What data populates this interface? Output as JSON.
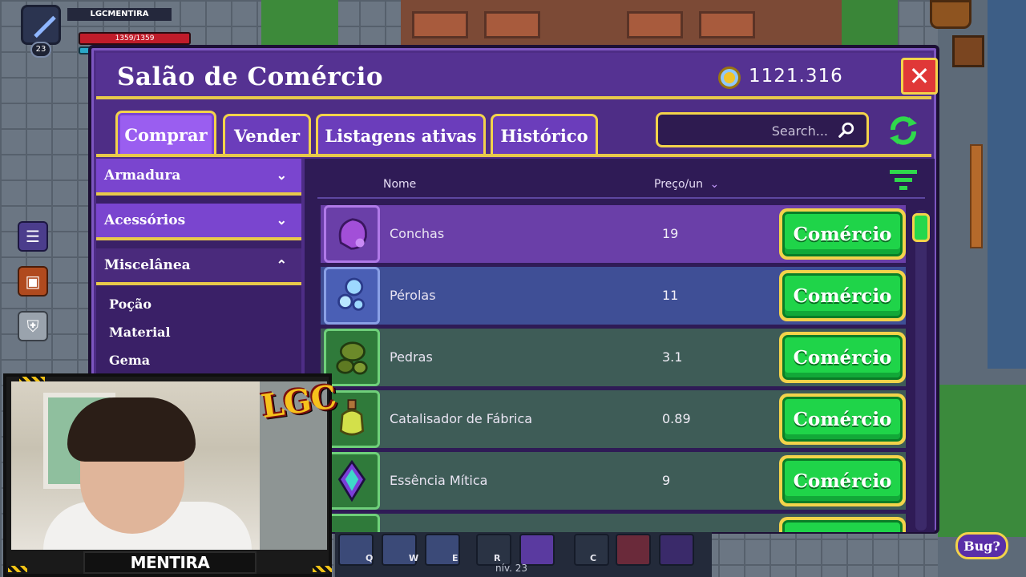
{
  "hud": {
    "player_name": "LGCMENTIRA",
    "hp": "1359/1359",
    "level": "23"
  },
  "window": {
    "title": "Salão de Comércio",
    "gold": "1121.316",
    "close_label": "✕"
  },
  "tabs": [
    {
      "label": "Comprar",
      "active": true
    },
    {
      "label": "Vender",
      "active": false
    },
    {
      "label": "Listagens ativas",
      "active": false
    },
    {
      "label": "Histórico",
      "active": false
    }
  ],
  "search": {
    "placeholder": "Search..."
  },
  "categories": [
    {
      "label": "Armadura",
      "chevron": "⌄"
    },
    {
      "label": "Acessórios",
      "chevron": "⌄"
    },
    {
      "label": "Miscelânea",
      "chevron": "⌃"
    }
  ],
  "subcategories": [
    "Poção",
    "Material",
    "Gema"
  ],
  "columns": {
    "name": "Nome",
    "price": "Preço/un",
    "price_sort_icon": "⌄"
  },
  "items": [
    {
      "name": "Conchas",
      "price": "19",
      "icon": "shell-icon",
      "color": "#8a3fd1"
    },
    {
      "name": "Pérolas",
      "price": "11",
      "icon": "pearls-icon",
      "color": "#4a5fb5"
    },
    {
      "name": "Pedras",
      "price": "3.1",
      "icon": "stones-icon",
      "color": "#2f7a3a"
    },
    {
      "name": "Catalisador de Fábrica",
      "price": "0.89",
      "icon": "potion-icon",
      "color": "#2f7a3a"
    },
    {
      "name": "Essência Mítica",
      "price": "9",
      "icon": "essence-icon",
      "color": "#2f7a3a"
    }
  ],
  "trade_button_label": "Comércio",
  "skills": [
    {
      "key": "Q"
    },
    {
      "key": "W"
    },
    {
      "key": "E"
    },
    {
      "key": "R"
    },
    {
      "key": "C"
    }
  ],
  "bottom": {
    "level_text": "nív. 23",
    "bug_label": "Bug?"
  },
  "overlay": {
    "streamer_name": "MENTIRA",
    "logo": "LGC"
  },
  "colors": {
    "window_purple": "#4e2d86",
    "accent_gold": "#f3d34a",
    "trade_green": "#1fd449",
    "close_red": "#e03838"
  }
}
